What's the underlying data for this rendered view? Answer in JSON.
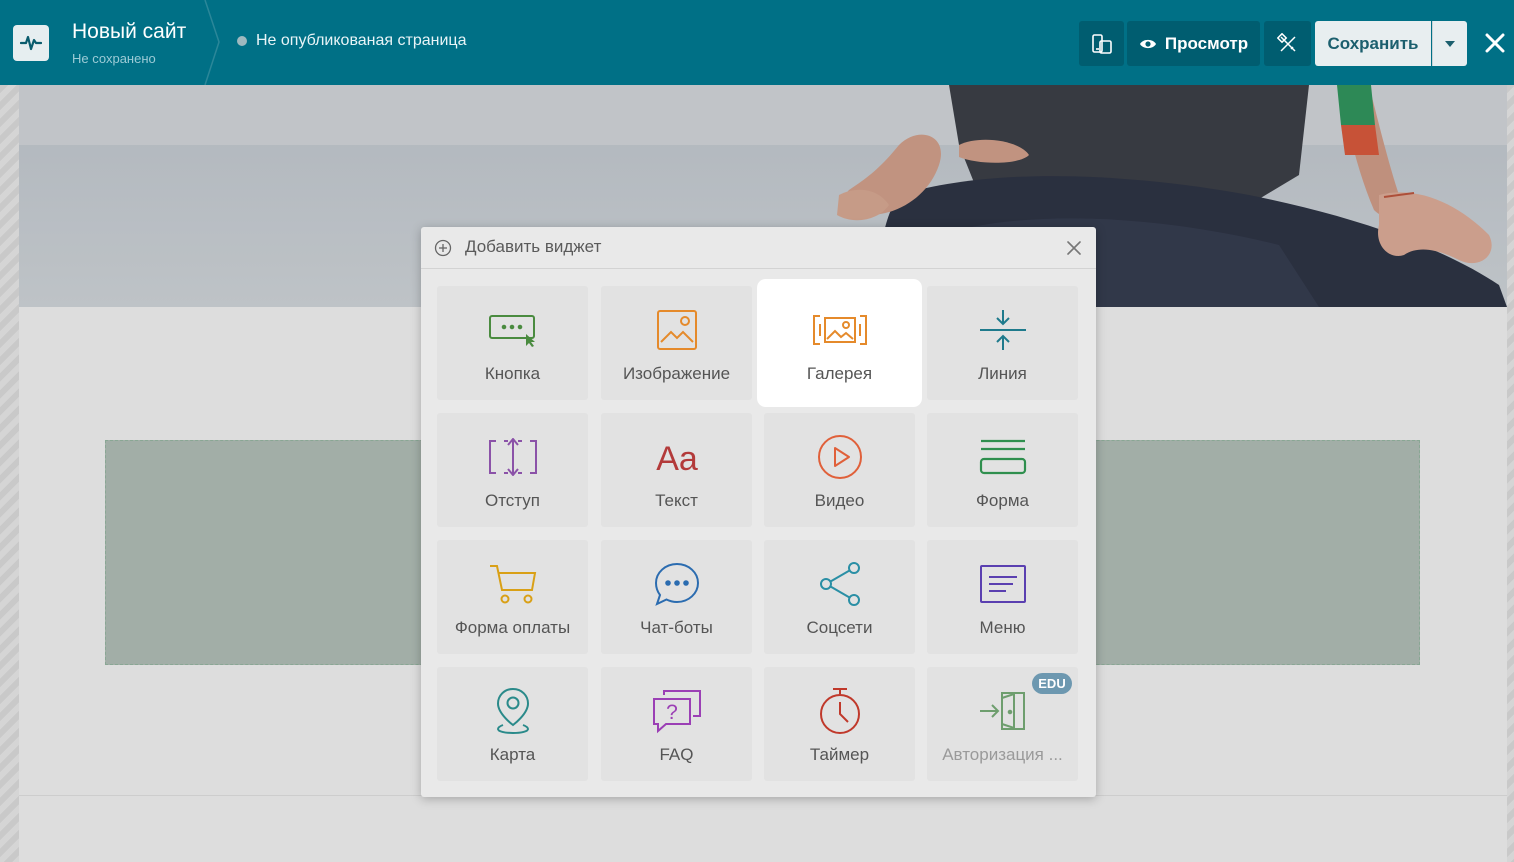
{
  "header": {
    "site_title": "Новый сайт",
    "site_status": "Не сохранено",
    "page_status": "Не опубликованая страница",
    "preview_label": "Просмотр",
    "save_label": "Сохранить"
  },
  "modal": {
    "title": "Добавить виджет",
    "widgets": [
      {
        "label": "Кнопка",
        "icon": "button-icon",
        "color": "#4a8b3f"
      },
      {
        "label": "Изображение",
        "icon": "image-icon",
        "color": "#e58a2b"
      },
      {
        "label": "Галерея",
        "icon": "gallery-icon",
        "color": "#e58a2b"
      },
      {
        "label": "Линия",
        "icon": "line-icon",
        "color": "#1e7a8c"
      },
      {
        "label": "Отступ",
        "icon": "spacing-icon",
        "color": "#8b52a8"
      },
      {
        "label": "Текст",
        "icon": "text-icon",
        "color": "#b33a3a"
      },
      {
        "label": "Видео",
        "icon": "video-icon",
        "color": "#e0603a"
      },
      {
        "label": "Форма",
        "icon": "form-icon",
        "color": "#2f8f4e"
      },
      {
        "label": "Форма оплаты",
        "icon": "cart-icon",
        "color": "#d9a016"
      },
      {
        "label": "Чат-боты",
        "icon": "chat-icon",
        "color": "#2b6cb0"
      },
      {
        "label": "Соцсети",
        "icon": "share-icon",
        "color": "#2a8fa5"
      },
      {
        "label": "Меню",
        "icon": "menu-icon",
        "color": "#5a3fb0"
      },
      {
        "label": "Карта",
        "icon": "map-pin-icon",
        "color": "#2a8a8a"
      },
      {
        "label": "FAQ",
        "icon": "faq-icon",
        "color": "#9b3fb5"
      },
      {
        "label": "Таймер",
        "icon": "timer-icon",
        "color": "#c0392b"
      },
      {
        "label": "Авторизация ...",
        "icon": "login-icon",
        "color": "#6e9e6e",
        "badge": "EDU"
      }
    ]
  }
}
